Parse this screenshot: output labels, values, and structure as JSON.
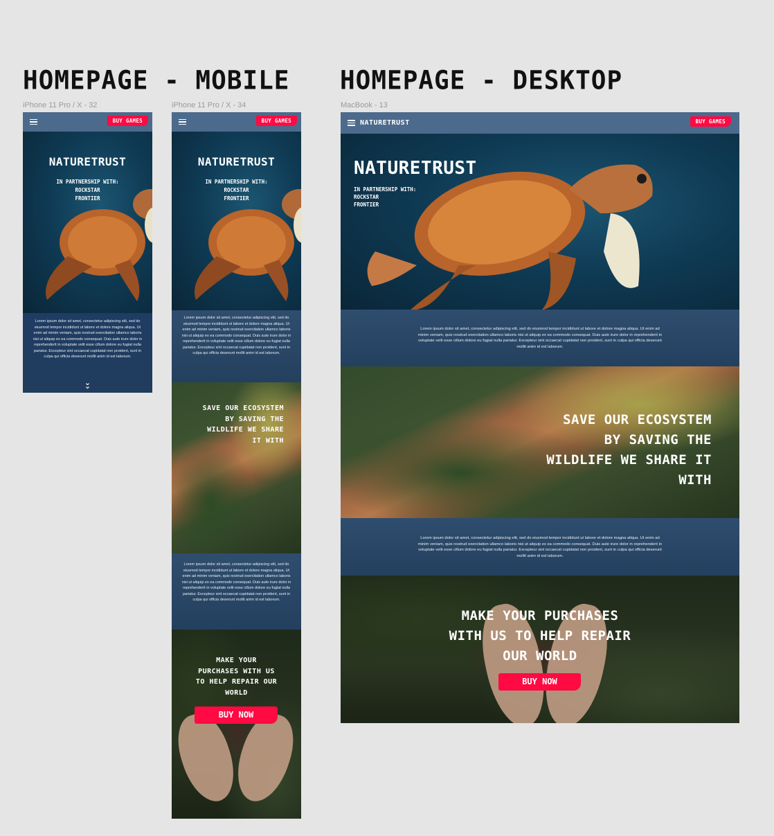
{
  "titles": {
    "mobile": "Homepage - Mobile",
    "desktop": "Homepage - Desktop"
  },
  "frame_labels": {
    "m1": "iPhone 11 Pro / X - 32",
    "m2": "iPhone 11 Pro / X - 34",
    "d": "MacBook - 13"
  },
  "nav": {
    "brand": "NatureTrust",
    "buy_games": "Buy Games"
  },
  "hero": {
    "title": "NatureTrust",
    "partnership_lines": [
      "In partnership with:",
      "Rockstar",
      "Frontier"
    ]
  },
  "lorem": "Lorem ipsum dolor sit amet, consectetur adipiscing elit, sed do eiusmod tempor incididunt ut labore et dolore magna aliqua. Ut enim ad minim veniam, quis nostrud exercitation ullamco laboris nisi ut aliquip ex ea commodo consequat. Duis aute irure dolor in reprehenderit in voluptate velit esse cillum dolore eu fugiat nulla pariatur. Excepteur sint occaecat cupidatat non proident, sunt in culpa qui officia deserunt mollit anim id est laborum.",
  "ecosystem": "Save our ecosystem by saving the wildlife we share it with",
  "purchase": "Make your purchases with us to help repair our world",
  "buy_now": "Buy Now",
  "icons": {
    "menu": "hamburger-icon",
    "scroll": "double-chevron-down-icon"
  },
  "colors": {
    "accent": "#ff0a43",
    "nav": "#4c6a8c",
    "band": "#2f4d6e"
  }
}
